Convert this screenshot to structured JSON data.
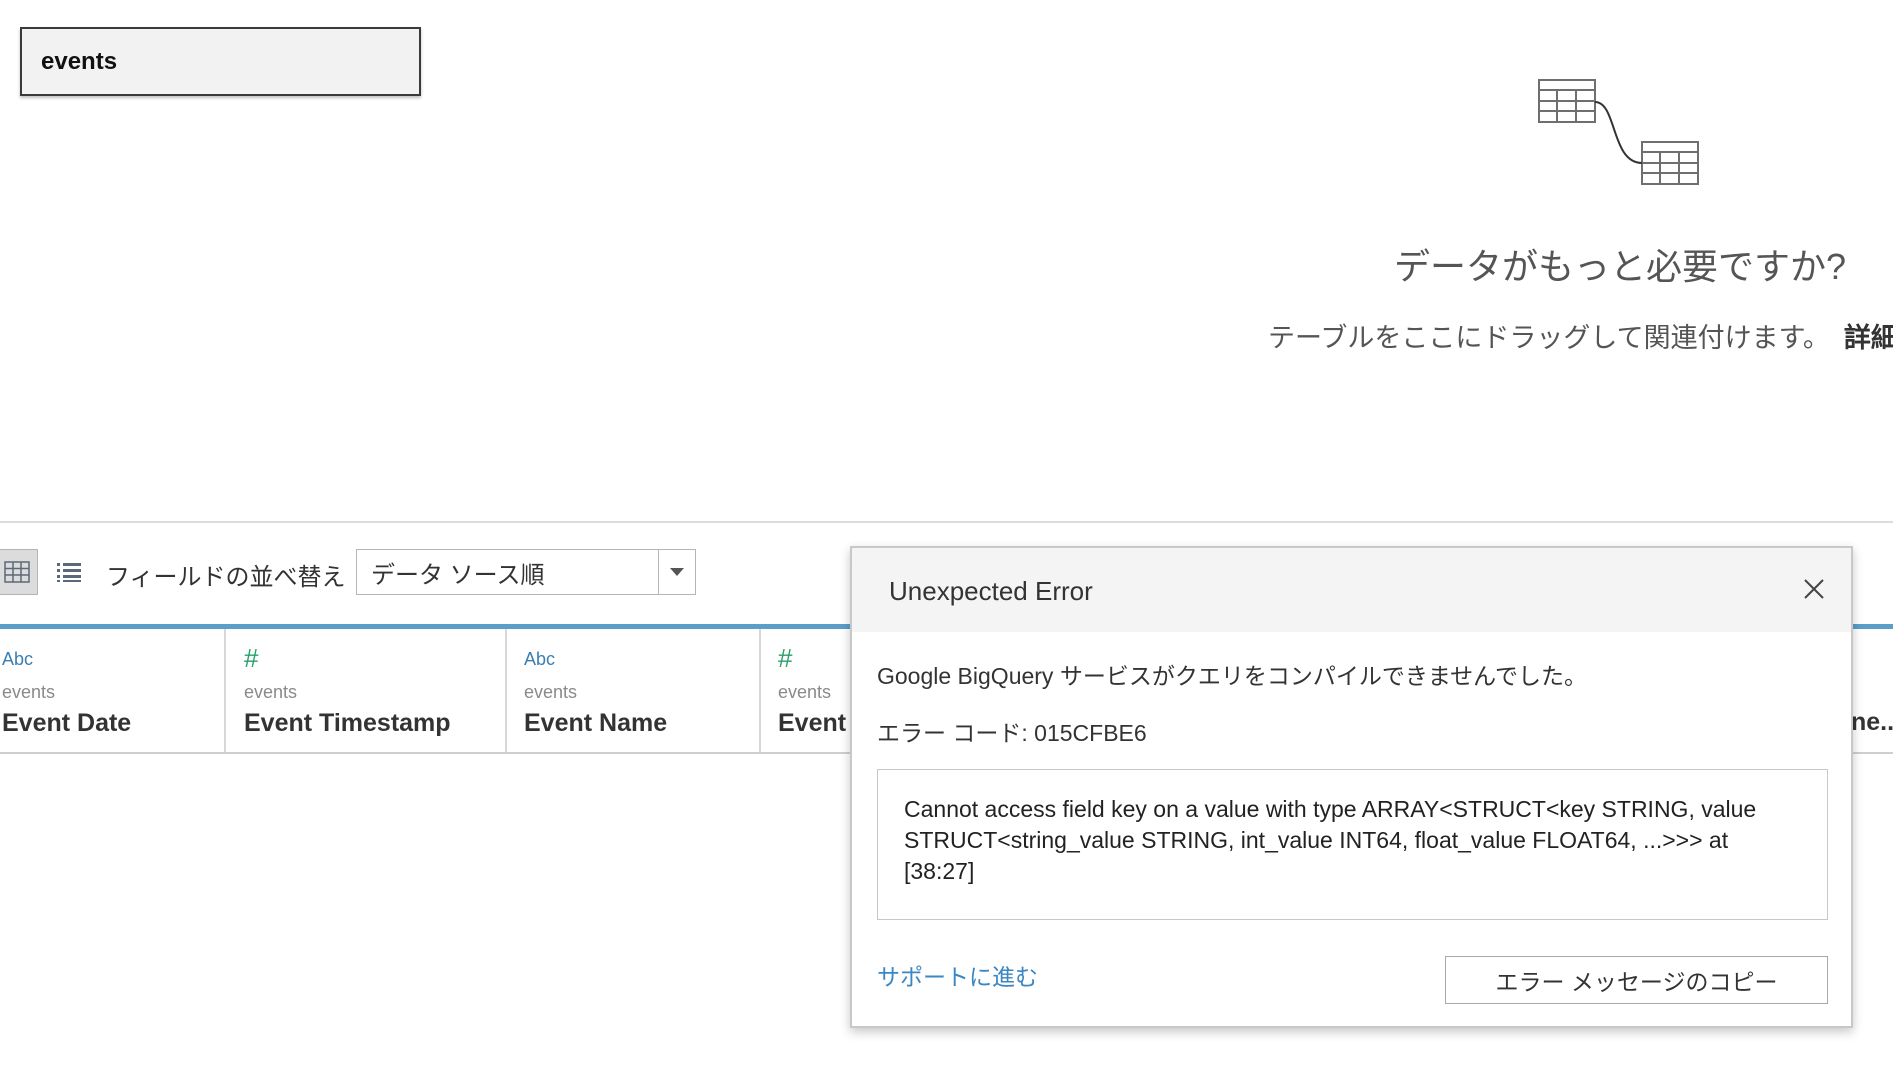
{
  "canvas": {
    "table_name": "events",
    "promo_title": "データがもっと必要ですか?",
    "promo_subtitle": "テーブルをここにドラッグして関連付けます。",
    "promo_link_partial": "詳細"
  },
  "toolbar": {
    "sort_label": "フィールドの並べ替え",
    "sort_value": "データ ソース順"
  },
  "fields": [
    {
      "type": "Abc",
      "source": "events",
      "name": "Event Date"
    },
    {
      "type": "#",
      "source": "events",
      "name": "Event Timestamp"
    },
    {
      "type": "Abc",
      "source": "events",
      "name": "Event Name"
    },
    {
      "type": "#",
      "source": "events",
      "name": "Event"
    }
  ],
  "fields_partial_right": "ne..",
  "dialog": {
    "title": "Unexpected Error",
    "message": "Google BigQuery サービスがクエリをコンパイルできませんでした。",
    "error_code": "エラー コード: 015CFBE6",
    "details": "Cannot access field key on a value with type ARRAY<STRUCT<key STRING, value STRUCT<string_value STRING, int_value INT64, float_value FLOAT64, ...>>> at [38:27]",
    "support_link": "サポートに進む",
    "copy_button": "エラー メッセージのコピー"
  },
  "colors": {
    "field_bar": "#5a9ec9",
    "abc_type": "#3b7fb0",
    "number_type": "#27a06a",
    "link": "#3b87c4"
  }
}
